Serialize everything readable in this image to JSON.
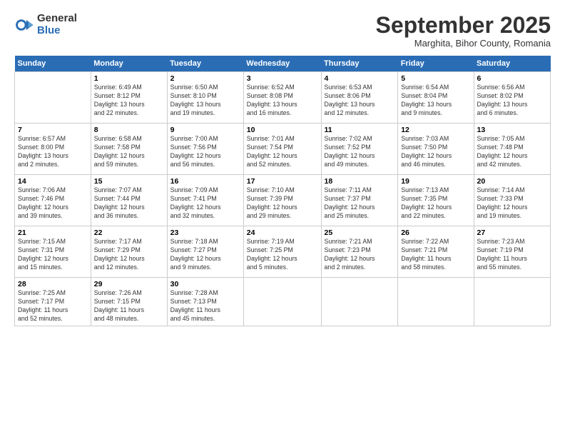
{
  "logo": {
    "general": "General",
    "blue": "Blue"
  },
  "title": "September 2025",
  "subtitle": "Marghita, Bihor County, Romania",
  "weekdays": [
    "Sunday",
    "Monday",
    "Tuesday",
    "Wednesday",
    "Thursday",
    "Friday",
    "Saturday"
  ],
  "weeks": [
    [
      {
        "num": "",
        "info": ""
      },
      {
        "num": "1",
        "info": "Sunrise: 6:49 AM\nSunset: 8:12 PM\nDaylight: 13 hours\nand 22 minutes."
      },
      {
        "num": "2",
        "info": "Sunrise: 6:50 AM\nSunset: 8:10 PM\nDaylight: 13 hours\nand 19 minutes."
      },
      {
        "num": "3",
        "info": "Sunrise: 6:52 AM\nSunset: 8:08 PM\nDaylight: 13 hours\nand 16 minutes."
      },
      {
        "num": "4",
        "info": "Sunrise: 6:53 AM\nSunset: 8:06 PM\nDaylight: 13 hours\nand 12 minutes."
      },
      {
        "num": "5",
        "info": "Sunrise: 6:54 AM\nSunset: 8:04 PM\nDaylight: 13 hours\nand 9 minutes."
      },
      {
        "num": "6",
        "info": "Sunrise: 6:56 AM\nSunset: 8:02 PM\nDaylight: 13 hours\nand 6 minutes."
      }
    ],
    [
      {
        "num": "7",
        "info": "Sunrise: 6:57 AM\nSunset: 8:00 PM\nDaylight: 13 hours\nand 2 minutes."
      },
      {
        "num": "8",
        "info": "Sunrise: 6:58 AM\nSunset: 7:58 PM\nDaylight: 12 hours\nand 59 minutes."
      },
      {
        "num": "9",
        "info": "Sunrise: 7:00 AM\nSunset: 7:56 PM\nDaylight: 12 hours\nand 56 minutes."
      },
      {
        "num": "10",
        "info": "Sunrise: 7:01 AM\nSunset: 7:54 PM\nDaylight: 12 hours\nand 52 minutes."
      },
      {
        "num": "11",
        "info": "Sunrise: 7:02 AM\nSunset: 7:52 PM\nDaylight: 12 hours\nand 49 minutes."
      },
      {
        "num": "12",
        "info": "Sunrise: 7:03 AM\nSunset: 7:50 PM\nDaylight: 12 hours\nand 46 minutes."
      },
      {
        "num": "13",
        "info": "Sunrise: 7:05 AM\nSunset: 7:48 PM\nDaylight: 12 hours\nand 42 minutes."
      }
    ],
    [
      {
        "num": "14",
        "info": "Sunrise: 7:06 AM\nSunset: 7:46 PM\nDaylight: 12 hours\nand 39 minutes."
      },
      {
        "num": "15",
        "info": "Sunrise: 7:07 AM\nSunset: 7:44 PM\nDaylight: 12 hours\nand 36 minutes."
      },
      {
        "num": "16",
        "info": "Sunrise: 7:09 AM\nSunset: 7:41 PM\nDaylight: 12 hours\nand 32 minutes."
      },
      {
        "num": "17",
        "info": "Sunrise: 7:10 AM\nSunset: 7:39 PM\nDaylight: 12 hours\nand 29 minutes."
      },
      {
        "num": "18",
        "info": "Sunrise: 7:11 AM\nSunset: 7:37 PM\nDaylight: 12 hours\nand 25 minutes."
      },
      {
        "num": "19",
        "info": "Sunrise: 7:13 AM\nSunset: 7:35 PM\nDaylight: 12 hours\nand 22 minutes."
      },
      {
        "num": "20",
        "info": "Sunrise: 7:14 AM\nSunset: 7:33 PM\nDaylight: 12 hours\nand 19 minutes."
      }
    ],
    [
      {
        "num": "21",
        "info": "Sunrise: 7:15 AM\nSunset: 7:31 PM\nDaylight: 12 hours\nand 15 minutes."
      },
      {
        "num": "22",
        "info": "Sunrise: 7:17 AM\nSunset: 7:29 PM\nDaylight: 12 hours\nand 12 minutes."
      },
      {
        "num": "23",
        "info": "Sunrise: 7:18 AM\nSunset: 7:27 PM\nDaylight: 12 hours\nand 9 minutes."
      },
      {
        "num": "24",
        "info": "Sunrise: 7:19 AM\nSunset: 7:25 PM\nDaylight: 12 hours\nand 5 minutes."
      },
      {
        "num": "25",
        "info": "Sunrise: 7:21 AM\nSunset: 7:23 PM\nDaylight: 12 hours\nand 2 minutes."
      },
      {
        "num": "26",
        "info": "Sunrise: 7:22 AM\nSunset: 7:21 PM\nDaylight: 11 hours\nand 58 minutes."
      },
      {
        "num": "27",
        "info": "Sunrise: 7:23 AM\nSunset: 7:19 PM\nDaylight: 11 hours\nand 55 minutes."
      }
    ],
    [
      {
        "num": "28",
        "info": "Sunrise: 7:25 AM\nSunset: 7:17 PM\nDaylight: 11 hours\nand 52 minutes."
      },
      {
        "num": "29",
        "info": "Sunrise: 7:26 AM\nSunset: 7:15 PM\nDaylight: 11 hours\nand 48 minutes."
      },
      {
        "num": "30",
        "info": "Sunrise: 7:28 AM\nSunset: 7:13 PM\nDaylight: 11 hours\nand 45 minutes."
      },
      {
        "num": "",
        "info": ""
      },
      {
        "num": "",
        "info": ""
      },
      {
        "num": "",
        "info": ""
      },
      {
        "num": "",
        "info": ""
      }
    ]
  ]
}
